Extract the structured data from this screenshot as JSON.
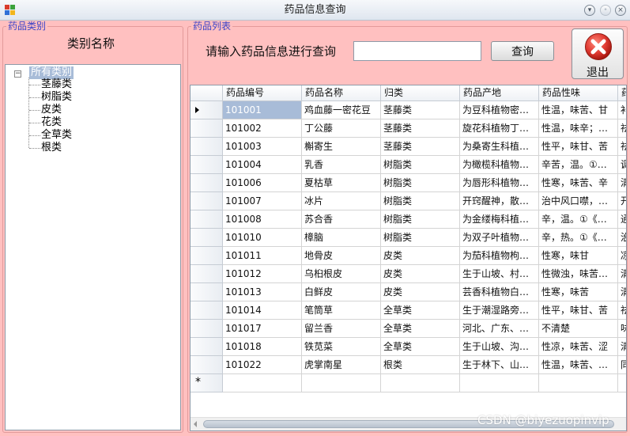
{
  "window": {
    "title": "药品信息查询"
  },
  "category_group": {
    "legend": "药品类别",
    "header": "类别名称",
    "tree": {
      "root": "所有类别",
      "toggle": "−",
      "items": [
        "茎藤类",
        "树脂类",
        "皮类",
        "花类",
        "全草类",
        "根类"
      ]
    }
  },
  "list_group": {
    "legend": "药品列表",
    "search": {
      "label": "请输入药品信息进行查询",
      "value": "",
      "placeholder": "",
      "button": "查询"
    },
    "exit_button": {
      "label": "退出",
      "icon": "close-circle-icon",
      "color": "#e03a32"
    },
    "table": {
      "columns": [
        "药品编号",
        "药品名称",
        "归类",
        "药品产地",
        "药品性味",
        "药"
      ],
      "rows": [
        [
          "101001",
          "鸡血藤一密花豆",
          "茎藤类",
          "为豆科植物密…",
          "性温，味苦、甘",
          "补"
        ],
        [
          "101002",
          "丁公藤",
          "茎藤类",
          "旋花科植物丁…",
          "性温，味辛；…",
          "祛"
        ],
        [
          "101003",
          "槲寄生",
          "茎藤类",
          "为桑寄生科植…",
          "性平，味甘、苦",
          "祛"
        ],
        [
          "101004",
          "乳香",
          "树脂类",
          "为橄榄科植物…",
          "辛苦，温。①…",
          "调"
        ],
        [
          "101006",
          "夏枯草",
          "树脂类",
          "为唇形科植物…",
          "性寒，味苦、辛",
          "清"
        ],
        [
          "101007",
          "冰片",
          "树脂类",
          "开窍醒神，散…",
          "治中风口噤，…",
          "开"
        ],
        [
          "101008",
          "苏合香",
          "树脂类",
          "为金缕梅科植…",
          "辛，温。①《…",
          "通"
        ],
        [
          "101010",
          "樟脑",
          "树脂类",
          "为双子叶植物…",
          "辛，热。①《…",
          "治"
        ],
        [
          "101011",
          "地骨皮",
          "皮类",
          "为茄科植物枸…",
          "性寒，味甘",
          "凉"
        ],
        [
          "101012",
          "乌桕根皮",
          "皮类",
          "生于山坡、村…",
          "性微浊，味苦…",
          "清"
        ],
        [
          "101013",
          "白鲜皮",
          "皮类",
          "芸香科植物白…",
          "性寒，味苦",
          "清"
        ],
        [
          "101014",
          "笔筒草",
          "全草类",
          "生于潮湿路旁…",
          "性平，味甘、苦",
          "祛"
        ],
        [
          "101017",
          "留兰香",
          "全草类",
          "河北、广东、…",
          "不清楚",
          "味"
        ],
        [
          "101018",
          "铁苋菜",
          "全草类",
          "生于山坡、沟…",
          "性凉，味苦、涩",
          "清"
        ],
        [
          "101022",
          "虎掌南星",
          "根类",
          "生于林下、山…",
          "性温，味苦、…",
          "同"
        ]
      ],
      "selected_row": 0,
      "new_row_marker": "*"
    }
  },
  "watermark": "CSDN @biyezuopinvip",
  "colors": {
    "background": "#ffc0c0",
    "legend_text": "#3b44c8",
    "selection": "#a8bcd8"
  }
}
